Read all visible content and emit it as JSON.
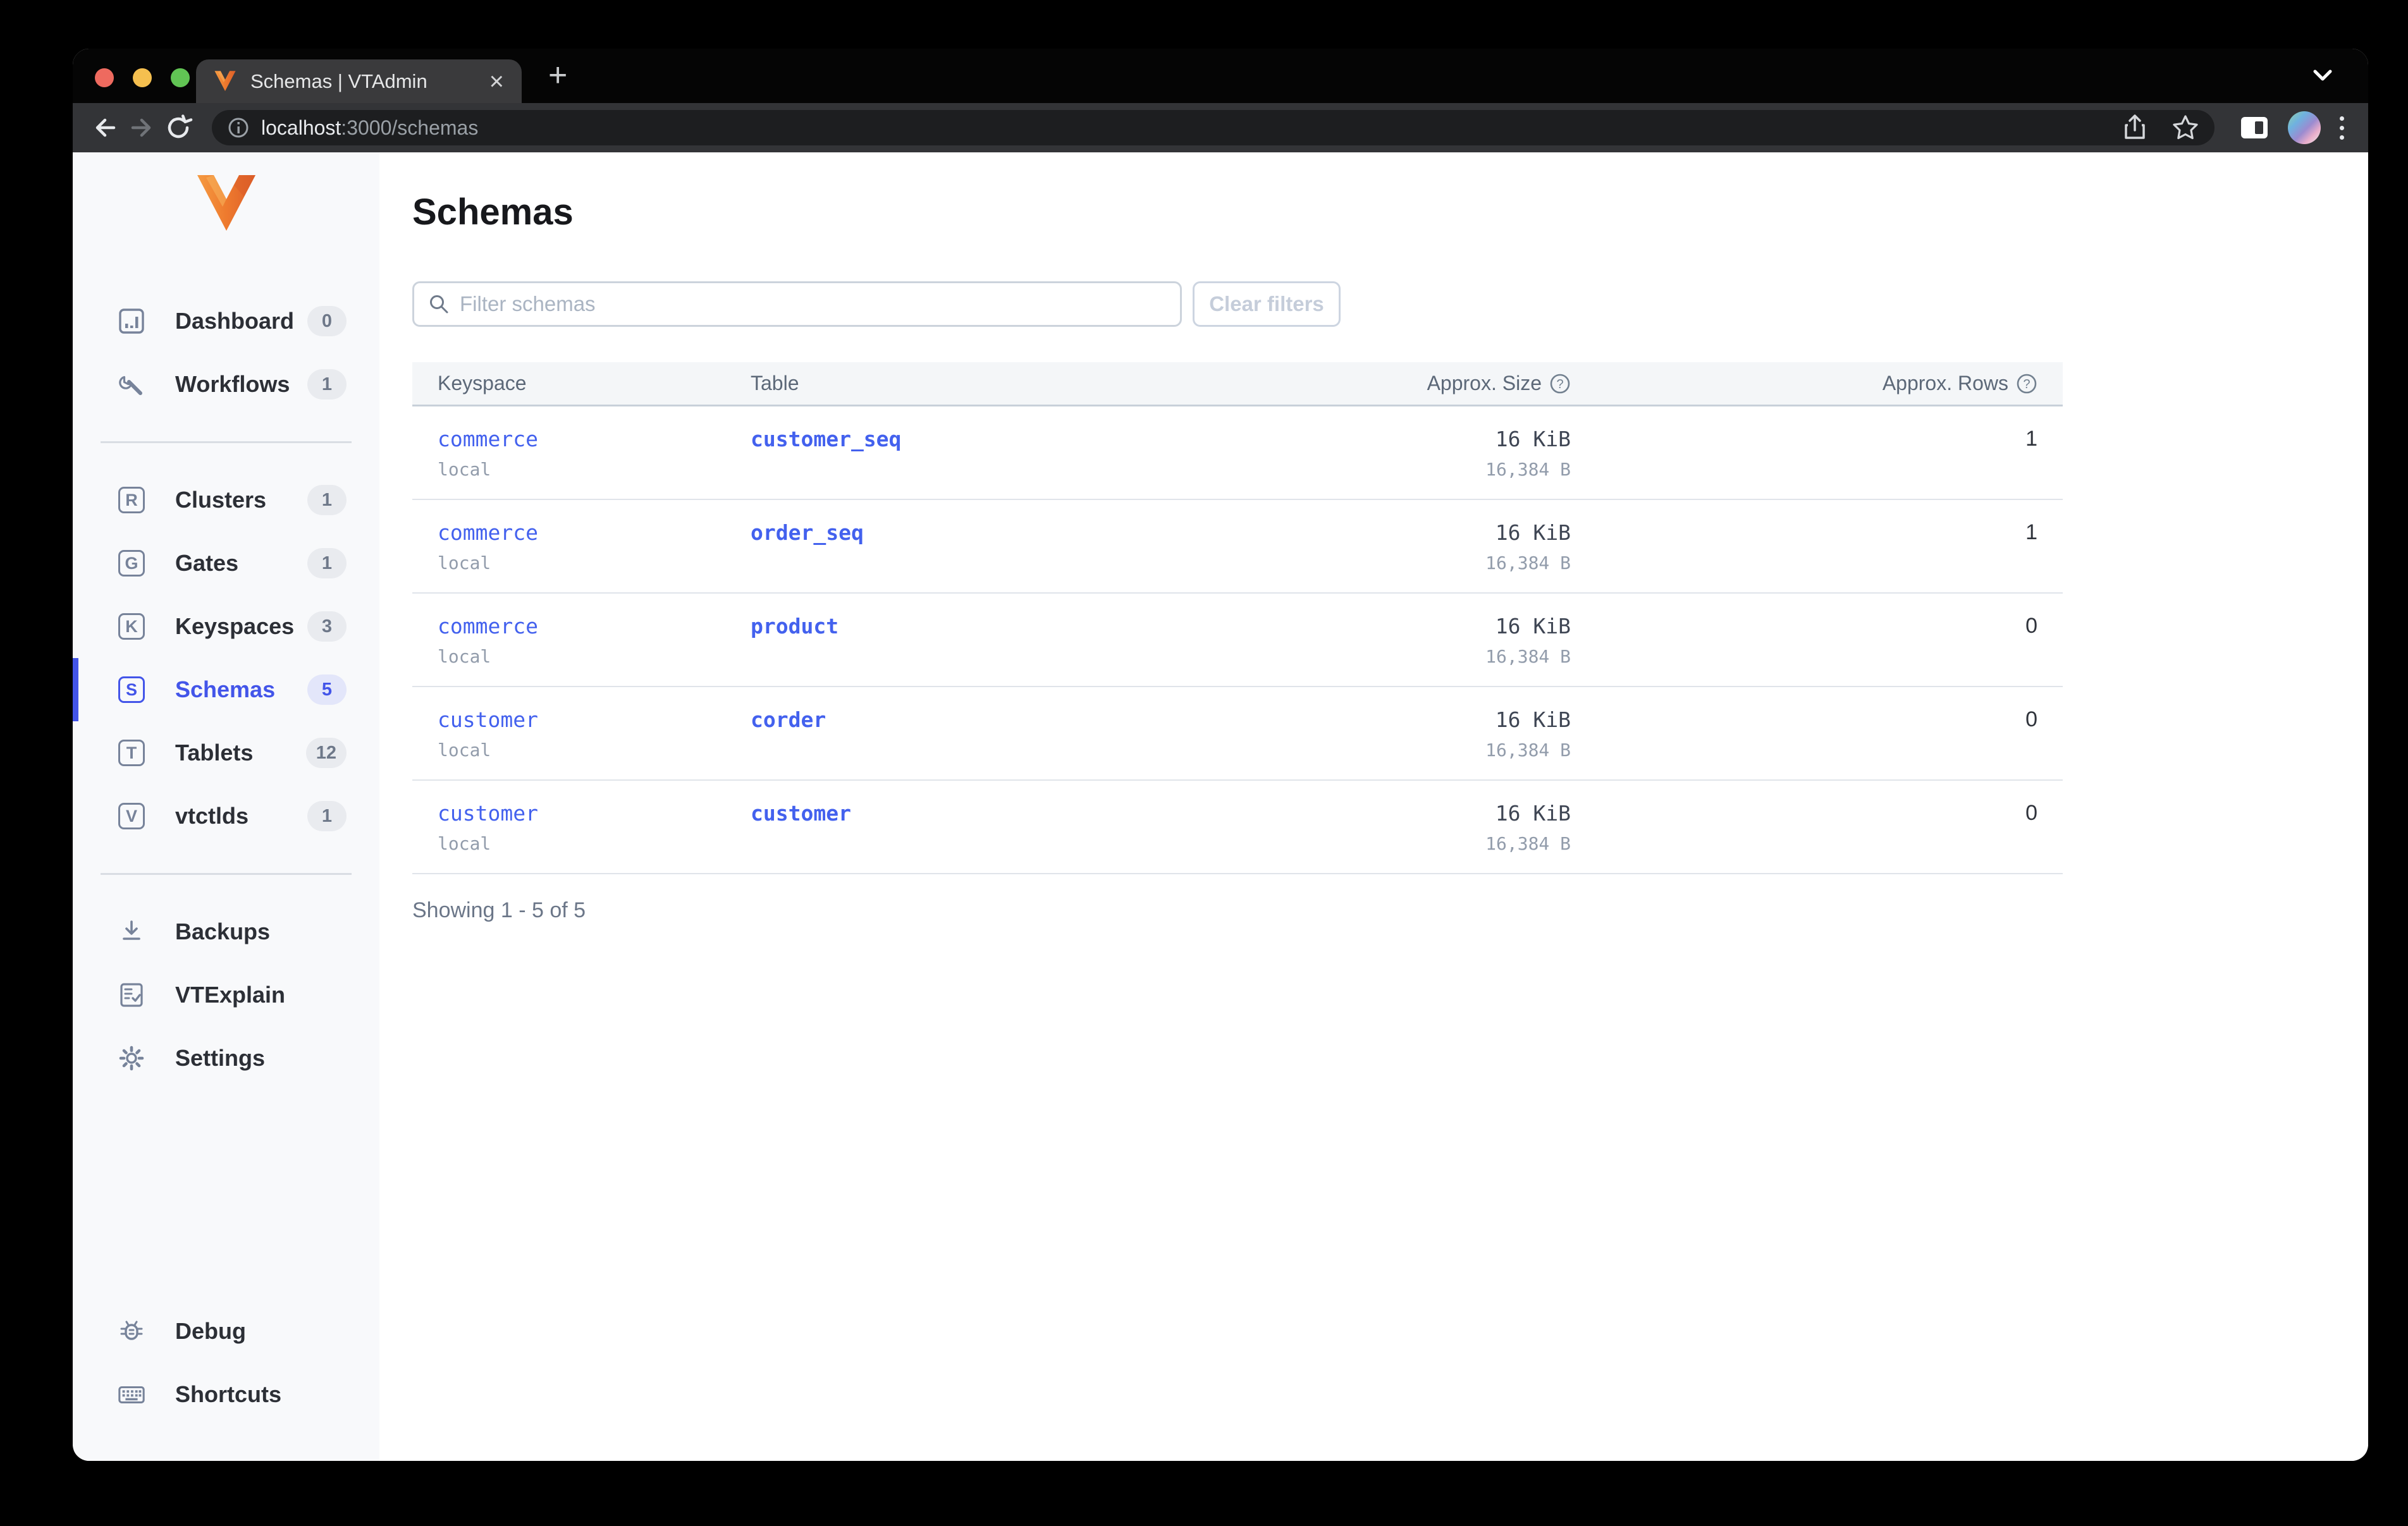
{
  "window": {
    "traffic_lights": {
      "close": "#ee6a5f",
      "minimize": "#f5bf4f",
      "zoom": "#61c454"
    }
  },
  "browser": {
    "tab": {
      "title": "Schemas | VTAdmin",
      "close_label": "×"
    },
    "new_tab_label": "+",
    "toolbar": {
      "url_host": "localhost",
      "url_rest": ":3000/schemas"
    }
  },
  "sidebar": {
    "nav_primary": [
      {
        "label": "Dashboard",
        "badge": "0",
        "icon": "bar-chart-icon"
      },
      {
        "label": "Workflows",
        "badge": "1",
        "icon": "wrench-icon"
      }
    ],
    "nav_resources": [
      {
        "label": "Clusters",
        "badge": "1",
        "icon_letter": "R"
      },
      {
        "label": "Gates",
        "badge": "1",
        "icon_letter": "G"
      },
      {
        "label": "Keyspaces",
        "badge": "3",
        "icon_letter": "K"
      },
      {
        "label": "Schemas",
        "badge": "5",
        "icon_letter": "S",
        "active": true
      },
      {
        "label": "Tablets",
        "badge": "12",
        "icon_letter": "T"
      },
      {
        "label": "vtctlds",
        "badge": "1",
        "icon_letter": "V"
      }
    ],
    "nav_tools": [
      {
        "label": "Backups",
        "icon": "download-icon"
      },
      {
        "label": "VTExplain",
        "icon": "document-check-icon"
      },
      {
        "label": "Settings",
        "icon": "gear-icon"
      }
    ],
    "nav_bottom": [
      {
        "label": "Debug",
        "icon": "bug-icon"
      },
      {
        "label": "Shortcuts",
        "icon": "keyboard-icon"
      }
    ]
  },
  "main": {
    "title": "Schemas",
    "filter": {
      "placeholder": "Filter schemas",
      "clear_label": "Clear filters"
    },
    "table": {
      "headers": {
        "keyspace": "Keyspace",
        "table": "Table",
        "size": "Approx. Size",
        "rows": "Approx. Rows"
      },
      "rows": [
        {
          "keyspace": "commerce",
          "cluster": "local",
          "table": "customer_seq",
          "size": "16 KiB",
          "size_bytes": "16,384 B",
          "rows": "1"
        },
        {
          "keyspace": "commerce",
          "cluster": "local",
          "table": "order_seq",
          "size": "16 KiB",
          "size_bytes": "16,384 B",
          "rows": "1"
        },
        {
          "keyspace": "commerce",
          "cluster": "local",
          "table": "product",
          "size": "16 KiB",
          "size_bytes": "16,384 B",
          "rows": "0"
        },
        {
          "keyspace": "customer",
          "cluster": "local",
          "table": "corder",
          "size": "16 KiB",
          "size_bytes": "16,384 B",
          "rows": "0"
        },
        {
          "keyspace": "customer",
          "cluster": "local",
          "table": "customer",
          "size": "16 KiB",
          "size_bytes": "16,384 B",
          "rows": "0"
        }
      ],
      "footer": "Showing 1 - 5 of 5"
    }
  },
  "colors": {
    "accent": "#4355e9",
    "link": "#4361ee"
  }
}
